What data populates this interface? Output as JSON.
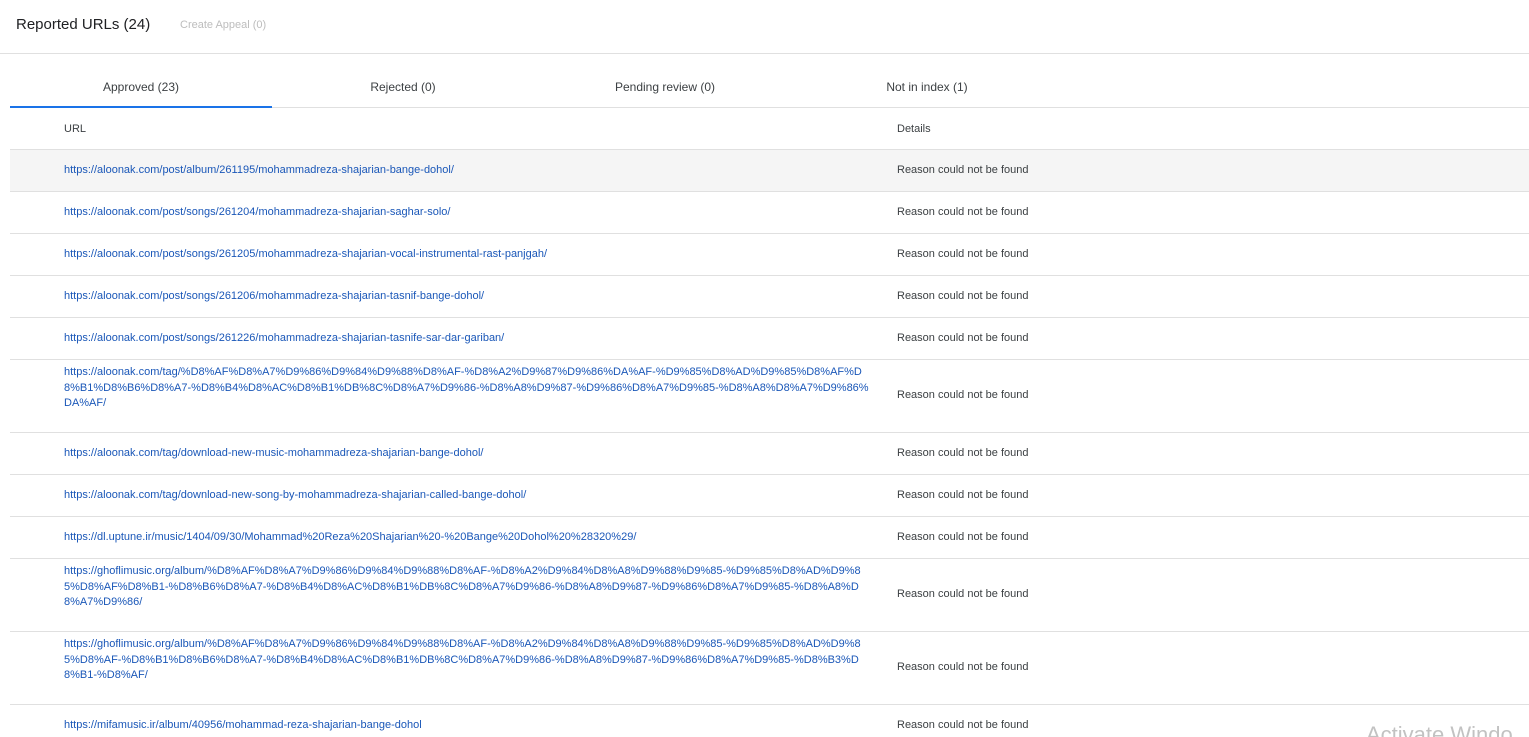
{
  "top_tabs": {
    "reported": "Reported URLs (24)",
    "appeal": "Create Appeal (0)"
  },
  "status_tabs": [
    {
      "label": "Approved (23)"
    },
    {
      "label": "Rejected (0)"
    },
    {
      "label": "Pending review (0)"
    },
    {
      "label": "Not in index (1)"
    }
  ],
  "table": {
    "headers": {
      "url": "URL",
      "details": "Details"
    },
    "rows": [
      {
        "url": "https://aloonak.com/post/album/261195/mohammadreza-shajarian-bange-dohol/",
        "details": "Reason could not be found"
      },
      {
        "url": "https://aloonak.com/post/songs/261204/mohammadreza-shajarian-saghar-solo/",
        "details": "Reason could not be found"
      },
      {
        "url": "https://aloonak.com/post/songs/261205/mohammadreza-shajarian-vocal-instrumental-rast-panjgah/",
        "details": "Reason could not be found"
      },
      {
        "url": "https://aloonak.com/post/songs/261206/mohammadreza-shajarian-tasnif-bange-dohol/",
        "details": "Reason could not be found"
      },
      {
        "url": "https://aloonak.com/post/songs/261226/mohammadreza-shajarian-tasnife-sar-dar-gariban/",
        "details": "Reason could not be found"
      },
      {
        "url": "https://aloonak.com/tag/%D8%AF%D8%A7%D9%86%D9%84%D9%88%D8%AF-%D8%A2%D9%87%D9%86%DA%AF-%D9%85%D8%AD%D9%85%D8%AF%D8%B1%D8%B6%D8%A7-%D8%B4%D8%AC%D8%B1%DB%8C%D8%A7%D9%86-%D8%A8%D9%87-%D9%86%D8%A7%D9%85-%D8%A8%D8%A7%D9%86%DA%AF/",
        "details": "Reason could not be found"
      },
      {
        "url": "https://aloonak.com/tag/download-new-music-mohammadreza-shajarian-bange-dohol/",
        "details": "Reason could not be found"
      },
      {
        "url": "https://aloonak.com/tag/download-new-song-by-mohammadreza-shajarian-called-bange-dohol/",
        "details": "Reason could not be found"
      },
      {
        "url": "https://dl.uptune.ir/music/1404/09/30/Mohammad%20Reza%20Shajarian%20-%20Bange%20Dohol%20%28320%29/",
        "details": "Reason could not be found"
      },
      {
        "url": "https://ghoflimusic.org/album/%D8%AF%D8%A7%D9%86%D9%84%D9%88%D8%AF-%D8%A2%D9%84%D8%A8%D9%88%D9%85-%D9%85%D8%AD%D9%85%D8%AF%D8%B1-%D8%B6%D8%A7-%D8%B4%D8%AC%D8%B1%DB%8C%D8%A7%D9%86-%D8%A8%D9%87-%D9%86%D8%A7%D9%85-%D8%A8%D8%A7%D9%86/",
        "details": "Reason could not be found"
      },
      {
        "url": "https://ghoflimusic.org/album/%D8%AF%D8%A7%D9%86%D9%84%D9%88%D8%AF-%D8%A2%D9%84%D8%A8%D9%88%D9%85-%D9%85%D8%AD%D9%85%D8%AF-%D8%B1%D8%B6%D8%A7-%D8%B4%D8%AC%D8%B1%DB%8C%D8%A7%D9%86-%D8%A8%D9%87-%D9%86%D8%A7%D9%85-%D8%B3%D8%B1-%D8%AF/",
        "details": "Reason could not be found"
      },
      {
        "url": "https://mifamusic.ir/album/40956/mohammad-reza-shajarian-bange-dohol",
        "details": "Reason could not be found"
      }
    ]
  },
  "watermark": "Activate Windo"
}
